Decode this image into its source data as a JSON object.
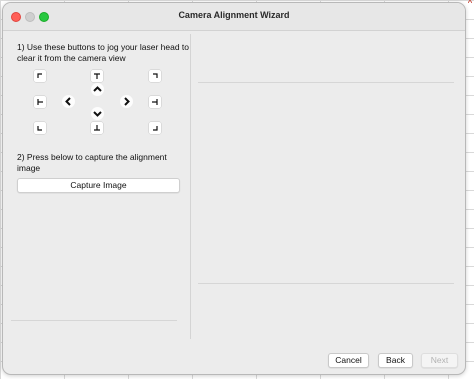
{
  "window": {
    "title": "Camera Alignment Wizard"
  },
  "steps": {
    "step1": "1) Use these buttons to jog your laser head to clear it from the camera view",
    "step2": "2) Press below to capture the alignment image",
    "capture_label": "Capture Image"
  },
  "jog_pad": {
    "buttons": [
      "jog-top-left",
      "jog-top",
      "jog-top-right",
      "jog-left",
      "jog-right",
      "jog-bottom-left",
      "jog-bottom",
      "jog-bottom-right"
    ],
    "arrows": [
      "chevron-up-icon",
      "chevron-left-icon",
      "chevron-right-icon",
      "chevron-down-icon"
    ]
  },
  "footer": {
    "cancel_label": "Cancel",
    "back_label": "Back",
    "next_label": "Next"
  },
  "colors": {
    "window_bg": "#ececec",
    "close": "#ff5f57",
    "maximize": "#28c840",
    "disabled_text": "#b2b2b2"
  }
}
